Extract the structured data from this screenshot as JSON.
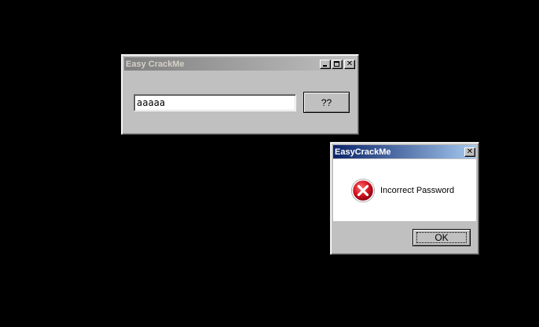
{
  "main_window": {
    "title": "Easy CrackMe",
    "password_value": "aaaaa",
    "check_button_label": "??",
    "controls": {
      "minimize_icon": "minimize-icon",
      "maximize_icon": "maximize-icon",
      "close_icon": "close-icon"
    }
  },
  "message_box": {
    "title": "EasyCrackMe",
    "message": "Incorrect Password",
    "ok_label": "OK",
    "icon": "error-icon",
    "icon_color": "#c8102e"
  },
  "colors": {
    "desktop": "#000000",
    "window_face": "#c0c0c0",
    "active_title_start": "#0a246a",
    "active_title_end": "#a6caf0",
    "inactive_title_start": "#808080"
  }
}
